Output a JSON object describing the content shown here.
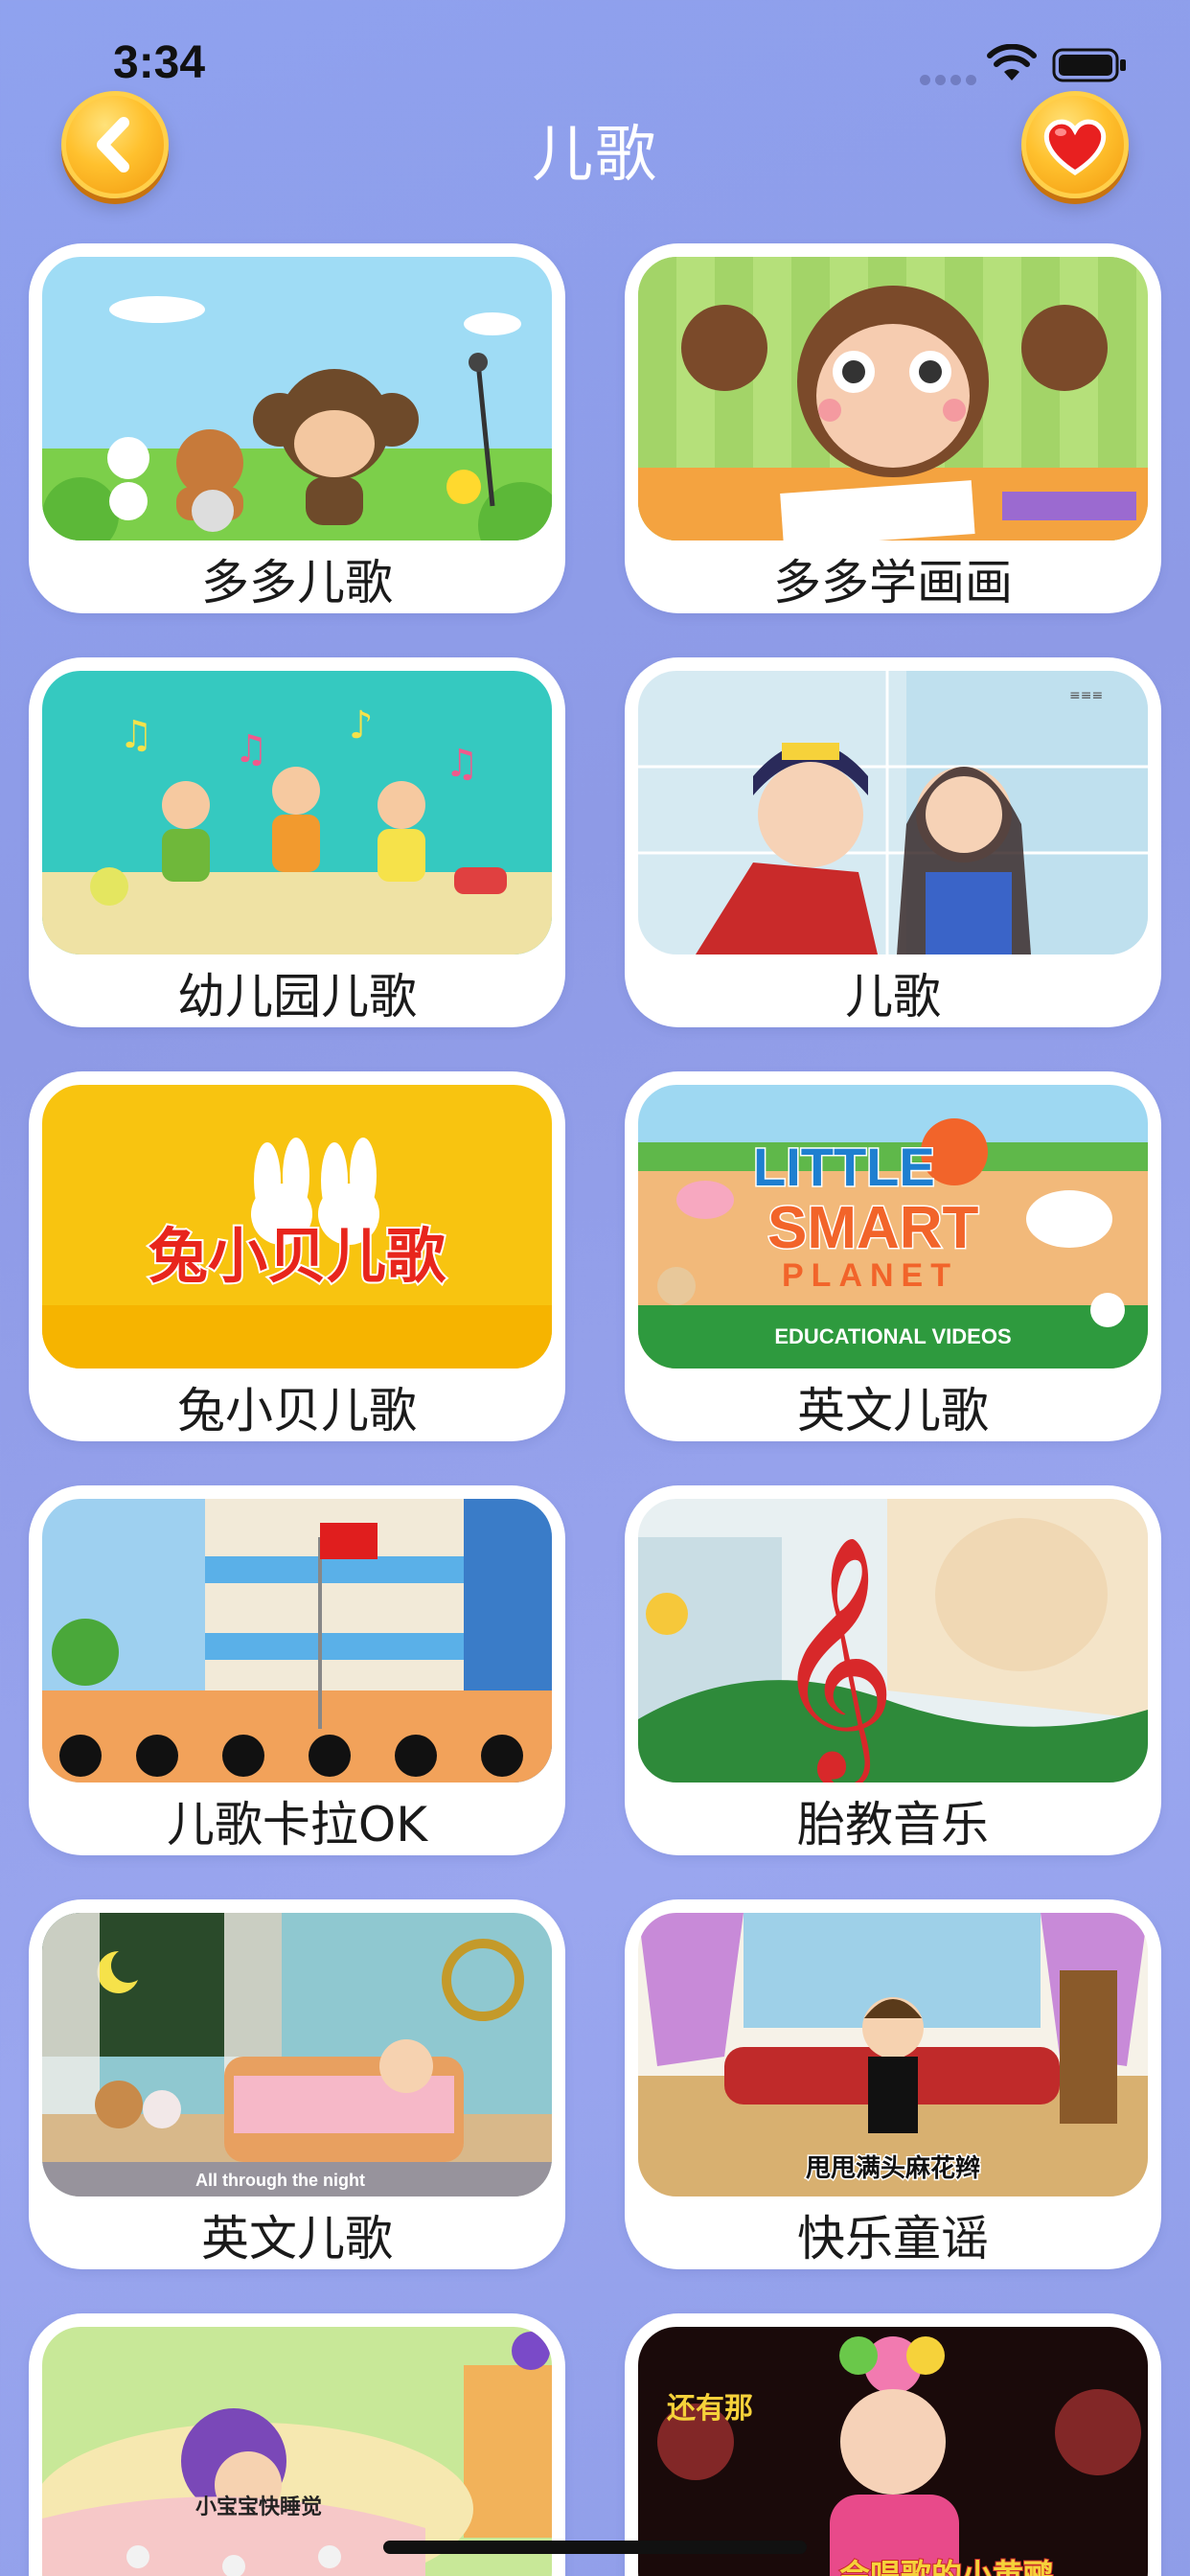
{
  "status_bar": {
    "time": "3:34"
  },
  "nav": {
    "title": "儿歌"
  },
  "colors": {
    "background": "#8e9ae6",
    "button_gold": "#ffc12e",
    "heart_red": "#e82020"
  },
  "cards": [
    {
      "label": "多多儿歌",
      "thumb": "monkey-band"
    },
    {
      "label": "多多学画画",
      "thumb": "monkey-drawing"
    },
    {
      "label": "幼儿园儿歌",
      "thumb": "kids-dancing"
    },
    {
      "label": "儿歌",
      "thumb": "prince-princess"
    },
    {
      "label": "兔小贝儿歌",
      "thumb": "rabbits-logo",
      "thumb_text": "兔小贝儿歌"
    },
    {
      "label": "英文儿歌",
      "thumb": "little-smart-planet",
      "thumb_text": [
        "LITTLE",
        "SMART",
        "PLANET",
        "EDUCATIONAL VIDEOS"
      ]
    },
    {
      "label": "儿歌卡拉OK",
      "thumb": "school-building"
    },
    {
      "label": "胎教音乐",
      "thumb": "music-note"
    },
    {
      "label": "英文儿歌",
      "thumb": "bedroom-crib",
      "thumb_text": "All through the night"
    },
    {
      "label": "快乐童谣",
      "thumb": "girl-stage",
      "thumb_text": "甩甩满头麻花辫"
    },
    {
      "label": "",
      "thumb": "sleeping-child",
      "thumb_text": "小宝宝快睡觉"
    },
    {
      "label": "",
      "thumb": "girl-singing",
      "thumb_text": [
        "还有那",
        "会唱歌的小黄鹂"
      ]
    }
  ]
}
